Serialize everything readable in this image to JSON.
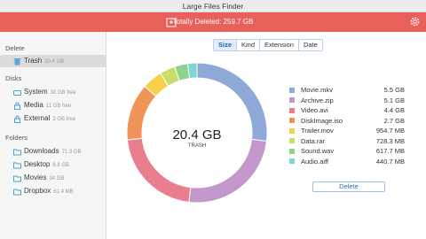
{
  "window": {
    "title": "Large Files Finder"
  },
  "header": {
    "summary": "Totally Deleted: 259.7 GB"
  },
  "sidebar": {
    "delete_title": "Delete",
    "trash": {
      "label": "Trash",
      "size": "20.4 GB"
    },
    "disks_title": "Disks",
    "disks": [
      {
        "label": "System",
        "size": "30 GB free"
      },
      {
        "label": "Media",
        "size": "11 GB free"
      },
      {
        "label": "External",
        "size": "2 GB free"
      }
    ],
    "folders_title": "Folders",
    "folders": [
      {
        "label": "Downloads",
        "size": "71.3 GB"
      },
      {
        "label": "Desktop",
        "size": "6.8 GB"
      },
      {
        "label": "Movies",
        "size": "34 GB"
      },
      {
        "label": "Dropbox",
        "size": "61.4 MB"
      }
    ]
  },
  "tabs": [
    "Size",
    "Kind",
    "Extension",
    "Date"
  ],
  "active_tab": "Size",
  "chart": {
    "center_value": "20.4 GB",
    "center_label": "TRASH"
  },
  "chart_data": {
    "type": "pie",
    "categories": [
      "Movie.mkv",
      "Archive.zip",
      "Video.avi",
      "DiskImage.iso",
      "Trailer.mov",
      "Data.rar",
      "Sound.wav",
      "Audio.aiff"
    ],
    "values_gb": [
      5.5,
      5.1,
      4.4,
      2.7,
      0.9547,
      0.7283,
      0.6177,
      0.4407
    ],
    "colors": [
      "#8ea8d8",
      "#c497cc",
      "#e97f8e",
      "#f19458",
      "#f7d047",
      "#c8dd6a",
      "#8cd48e",
      "#7fd7d0"
    ]
  },
  "legend": [
    {
      "name": "Movie.mkv",
      "value": "5.5 GB"
    },
    {
      "name": "Archive.zip",
      "value": "5.1 GB"
    },
    {
      "name": "Video.avi",
      "value": "4.4 GB"
    },
    {
      "name": "DiskImage.iso",
      "value": "2.7 GB"
    },
    {
      "name": "Trailer.mov",
      "value": "954.7 MB"
    },
    {
      "name": "Data.rar",
      "value": "728.3 MB"
    },
    {
      "name": "Sound.wav",
      "value": "617.7 MB"
    },
    {
      "name": "Audio.aiff",
      "value": "440.7 MB"
    }
  ],
  "delete_button": "Delete"
}
